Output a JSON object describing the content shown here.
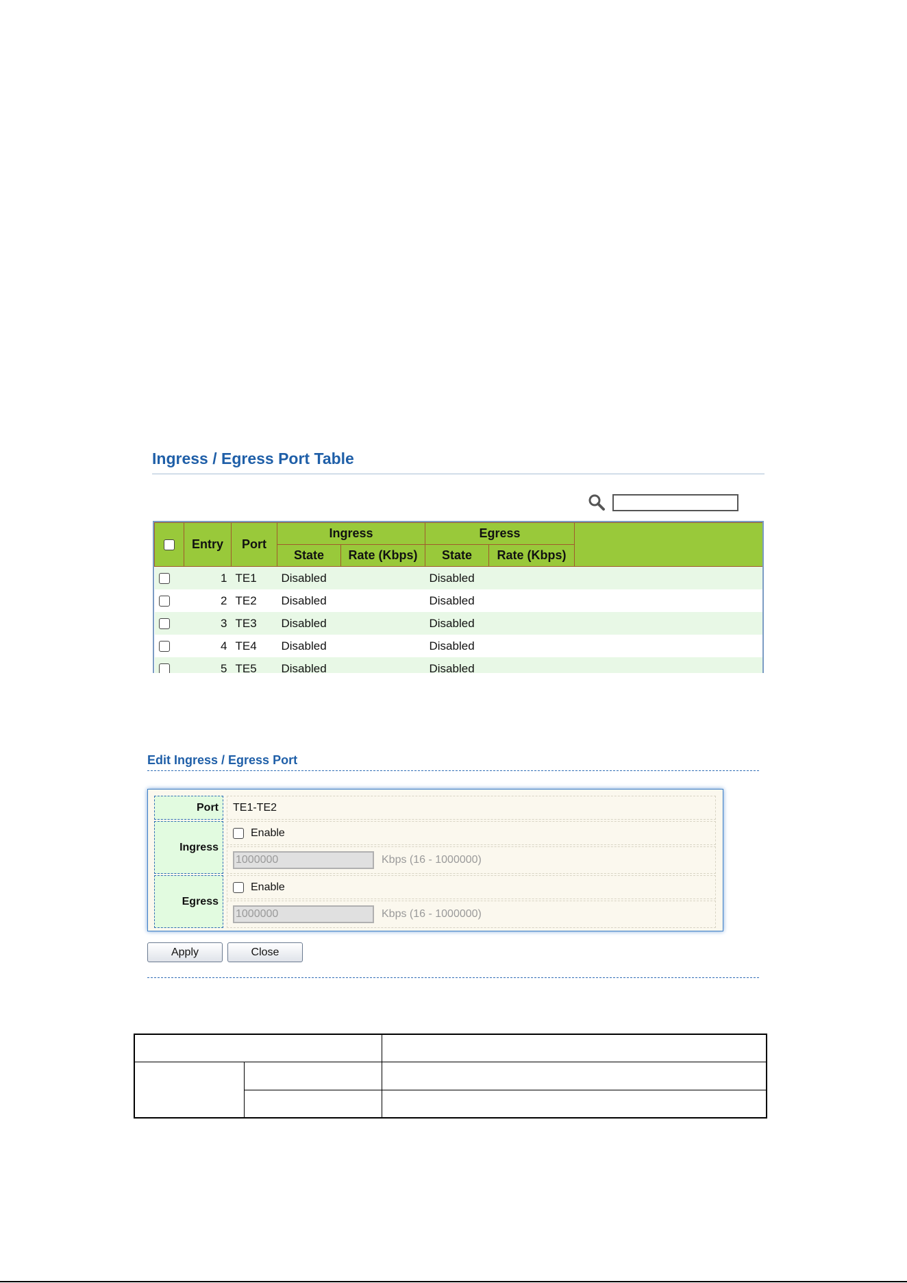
{
  "port_table": {
    "title": "Ingress / Egress Port Table",
    "search": {
      "value": ""
    },
    "headers": {
      "entry": "Entry",
      "port": "Port",
      "ingress": "Ingress",
      "egress": "Egress",
      "state": "State",
      "rate": "Rate (Kbps)"
    },
    "rows": [
      {
        "entry": "1",
        "port": "TE1",
        "ingress_state": "Disabled",
        "ingress_rate": "",
        "egress_state": "Disabled",
        "egress_rate": ""
      },
      {
        "entry": "2",
        "port": "TE2",
        "ingress_state": "Disabled",
        "ingress_rate": "",
        "egress_state": "Disabled",
        "egress_rate": ""
      },
      {
        "entry": "3",
        "port": "TE3",
        "ingress_state": "Disabled",
        "ingress_rate": "",
        "egress_state": "Disabled",
        "egress_rate": ""
      },
      {
        "entry": "4",
        "port": "TE4",
        "ingress_state": "Disabled",
        "ingress_rate": "",
        "egress_state": "Disabled",
        "egress_rate": ""
      },
      {
        "entry": "5",
        "port": "TE5",
        "ingress_state": "Disabled",
        "ingress_rate": "",
        "egress_state": "Disabled",
        "egress_rate": ""
      }
    ]
  },
  "edit_panel": {
    "title": "Edit Ingress / Egress Port",
    "port_label": "Port",
    "port_value": "TE1-TE2",
    "ingress_label": "Ingress",
    "egress_label": "Egress",
    "enable_label": "Enable",
    "ingress_rate": "1000000",
    "egress_rate": "1000000",
    "rate_unit": "Kbps (16 - 1000000)",
    "apply_label": "Apply",
    "close_label": "Close"
  },
  "colors": {
    "title_blue": "#1f5fa8",
    "header_green": "#99c93a",
    "row_alt": "#e8f8e6",
    "label_green": "#e2fbe0",
    "panel_bg": "#fbf8ee"
  },
  "icons": [
    "search-icon",
    "checkbox"
  ]
}
